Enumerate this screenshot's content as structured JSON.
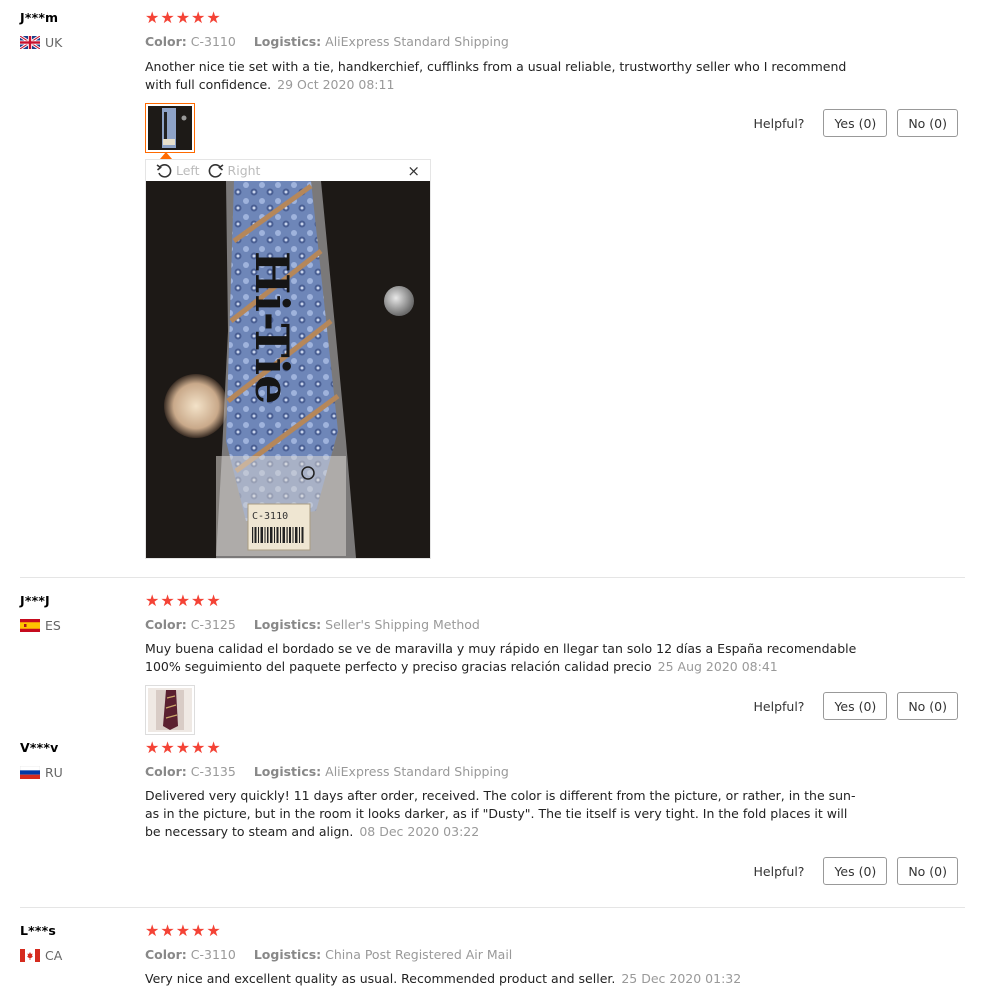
{
  "reviews": [
    {
      "user": "J***m",
      "country": "UK",
      "stars": "★★★★★",
      "color_label": "Color:",
      "color_value": "C-3110",
      "logistics_label": "Logistics:",
      "logistics_value": "AliExpress Standard Shipping",
      "text": "Another nice tie set with a tie, handkerchief, cufflinks from a usual reliable, trustworthy seller who I recommend with full confidence.",
      "date": "29 Oct 2020 08:11",
      "helpful_label": "Helpful?",
      "yes_label": "Yes (0)",
      "no_label": "No (0)"
    },
    {
      "user": "J***J",
      "country": "ES",
      "stars": "★★★★★",
      "color_label": "Color:",
      "color_value": "C-3125",
      "logistics_label": "Logistics:",
      "logistics_value": "Seller's Shipping Method",
      "text": "Muy buena calidad el bordado se ve de maravilla y muy rápido en llegar tan solo 12 días a España recomendable 100% seguimiento del paquete perfecto y preciso gracias relación calidad precio",
      "date": "25 Aug 2020 08:41",
      "helpful_label": "Helpful?",
      "yes_label": "Yes (0)",
      "no_label": "No (0)"
    },
    {
      "user": "V***v",
      "country": "RU",
      "stars": "★★★★★",
      "color_label": "Color:",
      "color_value": "C-3135",
      "logistics_label": "Logistics:",
      "logistics_value": "AliExpress Standard Shipping",
      "text": "Delivered very quickly! 11 days after order, received. The color is different from the picture, or rather, in the sun-as in the picture, but in the room it looks darker, as if \"Dusty\". The tie itself is very tight. In the fold places it will be necessary to steam and align.",
      "date": "08 Dec 2020 03:22",
      "helpful_label": "Helpful?",
      "yes_label": "Yes (0)",
      "no_label": "No (0)"
    },
    {
      "user": "L***s",
      "country": "CA",
      "stars": "★★★★★",
      "color_label": "Color:",
      "color_value": "C-3110",
      "logistics_label": "Logistics:",
      "logistics_value": "China Post Registered Air Mail",
      "text": "Very nice and excellent quality as usual. Recommended product and seller.",
      "date": "25 Dec 2020 01:32"
    }
  ],
  "viewer": {
    "left_label": "Left",
    "right_label": "Right",
    "close_glyph": "×",
    "tie_brand": "Hi-Tie",
    "tag_code": "C-3110"
  },
  "colors": {
    "star": "#f44336",
    "active_thumb": "#ff6a00"
  }
}
